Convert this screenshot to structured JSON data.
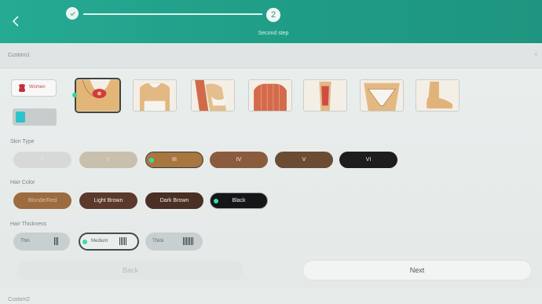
{
  "header": {
    "back_icon": "chevron-left-icon",
    "step1_icon": "check-icon",
    "step2_number": "2",
    "step2_label": "Second step"
  },
  "section": {
    "title": "Custom1",
    "next_title": "Custom2"
  },
  "gender": {
    "label": "Women",
    "icon": "female-torso-icon"
  },
  "body_areas": [
    {
      "name": "underarm",
      "selected": true
    },
    {
      "name": "chest",
      "selected": false
    },
    {
      "name": "arm",
      "selected": false
    },
    {
      "name": "back",
      "selected": false
    },
    {
      "name": "leg",
      "selected": false
    },
    {
      "name": "bikini",
      "selected": false
    },
    {
      "name": "foot",
      "selected": false
    }
  ],
  "skin_type": {
    "label": "Skin Type",
    "options": [
      "I",
      "II",
      "III",
      "IV",
      "V",
      "VI"
    ],
    "selected": "III",
    "colors": [
      "#d7dad8",
      "#c9c0ad",
      "#a9773f",
      "#8a5a3c",
      "#6a4a30",
      "#1d1d1f"
    ]
  },
  "hair_color": {
    "label": "Hair Color",
    "options": [
      "Blonde/Red",
      "Light Brown",
      "Dark Brown",
      "Black"
    ],
    "selected": "Black",
    "colors": [
      "#9c6a3e",
      "#5c3a2a",
      "#4a2f24",
      "#151618"
    ]
  },
  "hair_thickness": {
    "label": "Hair Thickness",
    "options": [
      "Thin",
      "Medium",
      "Thick"
    ],
    "selected": "Medium"
  },
  "buttons": {
    "back": "Back",
    "next": "Next"
  },
  "colors": {
    "accent": "#22a38c",
    "selection_dot": "#35dcb0"
  }
}
